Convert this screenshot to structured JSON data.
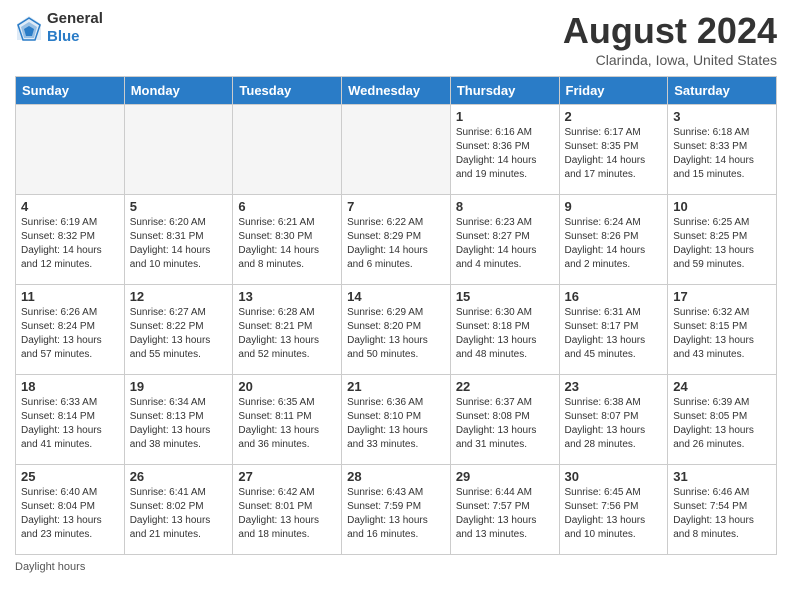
{
  "header": {
    "logo_general": "General",
    "logo_blue": "Blue",
    "month_title": "August 2024",
    "location": "Clarinda, Iowa, United States"
  },
  "weekdays": [
    "Sunday",
    "Monday",
    "Tuesday",
    "Wednesday",
    "Thursday",
    "Friday",
    "Saturday"
  ],
  "weeks": [
    [
      {
        "day": "",
        "info": ""
      },
      {
        "day": "",
        "info": ""
      },
      {
        "day": "",
        "info": ""
      },
      {
        "day": "",
        "info": ""
      },
      {
        "day": "1",
        "info": "Sunrise: 6:16 AM\nSunset: 8:36 PM\nDaylight: 14 hours and 19 minutes."
      },
      {
        "day": "2",
        "info": "Sunrise: 6:17 AM\nSunset: 8:35 PM\nDaylight: 14 hours and 17 minutes."
      },
      {
        "day": "3",
        "info": "Sunrise: 6:18 AM\nSunset: 8:33 PM\nDaylight: 14 hours and 15 minutes."
      }
    ],
    [
      {
        "day": "4",
        "info": "Sunrise: 6:19 AM\nSunset: 8:32 PM\nDaylight: 14 hours and 12 minutes."
      },
      {
        "day": "5",
        "info": "Sunrise: 6:20 AM\nSunset: 8:31 PM\nDaylight: 14 hours and 10 minutes."
      },
      {
        "day": "6",
        "info": "Sunrise: 6:21 AM\nSunset: 8:30 PM\nDaylight: 14 hours and 8 minutes."
      },
      {
        "day": "7",
        "info": "Sunrise: 6:22 AM\nSunset: 8:29 PM\nDaylight: 14 hours and 6 minutes."
      },
      {
        "day": "8",
        "info": "Sunrise: 6:23 AM\nSunset: 8:27 PM\nDaylight: 14 hours and 4 minutes."
      },
      {
        "day": "9",
        "info": "Sunrise: 6:24 AM\nSunset: 8:26 PM\nDaylight: 14 hours and 2 minutes."
      },
      {
        "day": "10",
        "info": "Sunrise: 6:25 AM\nSunset: 8:25 PM\nDaylight: 13 hours and 59 minutes."
      }
    ],
    [
      {
        "day": "11",
        "info": "Sunrise: 6:26 AM\nSunset: 8:24 PM\nDaylight: 13 hours and 57 minutes."
      },
      {
        "day": "12",
        "info": "Sunrise: 6:27 AM\nSunset: 8:22 PM\nDaylight: 13 hours and 55 minutes."
      },
      {
        "day": "13",
        "info": "Sunrise: 6:28 AM\nSunset: 8:21 PM\nDaylight: 13 hours and 52 minutes."
      },
      {
        "day": "14",
        "info": "Sunrise: 6:29 AM\nSunset: 8:20 PM\nDaylight: 13 hours and 50 minutes."
      },
      {
        "day": "15",
        "info": "Sunrise: 6:30 AM\nSunset: 8:18 PM\nDaylight: 13 hours and 48 minutes."
      },
      {
        "day": "16",
        "info": "Sunrise: 6:31 AM\nSunset: 8:17 PM\nDaylight: 13 hours and 45 minutes."
      },
      {
        "day": "17",
        "info": "Sunrise: 6:32 AM\nSunset: 8:15 PM\nDaylight: 13 hours and 43 minutes."
      }
    ],
    [
      {
        "day": "18",
        "info": "Sunrise: 6:33 AM\nSunset: 8:14 PM\nDaylight: 13 hours and 41 minutes."
      },
      {
        "day": "19",
        "info": "Sunrise: 6:34 AM\nSunset: 8:13 PM\nDaylight: 13 hours and 38 minutes."
      },
      {
        "day": "20",
        "info": "Sunrise: 6:35 AM\nSunset: 8:11 PM\nDaylight: 13 hours and 36 minutes."
      },
      {
        "day": "21",
        "info": "Sunrise: 6:36 AM\nSunset: 8:10 PM\nDaylight: 13 hours and 33 minutes."
      },
      {
        "day": "22",
        "info": "Sunrise: 6:37 AM\nSunset: 8:08 PM\nDaylight: 13 hours and 31 minutes."
      },
      {
        "day": "23",
        "info": "Sunrise: 6:38 AM\nSunset: 8:07 PM\nDaylight: 13 hours and 28 minutes."
      },
      {
        "day": "24",
        "info": "Sunrise: 6:39 AM\nSunset: 8:05 PM\nDaylight: 13 hours and 26 minutes."
      }
    ],
    [
      {
        "day": "25",
        "info": "Sunrise: 6:40 AM\nSunset: 8:04 PM\nDaylight: 13 hours and 23 minutes."
      },
      {
        "day": "26",
        "info": "Sunrise: 6:41 AM\nSunset: 8:02 PM\nDaylight: 13 hours and 21 minutes."
      },
      {
        "day": "27",
        "info": "Sunrise: 6:42 AM\nSunset: 8:01 PM\nDaylight: 13 hours and 18 minutes."
      },
      {
        "day": "28",
        "info": "Sunrise: 6:43 AM\nSunset: 7:59 PM\nDaylight: 13 hours and 16 minutes."
      },
      {
        "day": "29",
        "info": "Sunrise: 6:44 AM\nSunset: 7:57 PM\nDaylight: 13 hours and 13 minutes."
      },
      {
        "day": "30",
        "info": "Sunrise: 6:45 AM\nSunset: 7:56 PM\nDaylight: 13 hours and 10 minutes."
      },
      {
        "day": "31",
        "info": "Sunrise: 6:46 AM\nSunset: 7:54 PM\nDaylight: 13 hours and 8 minutes."
      }
    ]
  ],
  "footer": {
    "daylight_label": "Daylight hours"
  }
}
